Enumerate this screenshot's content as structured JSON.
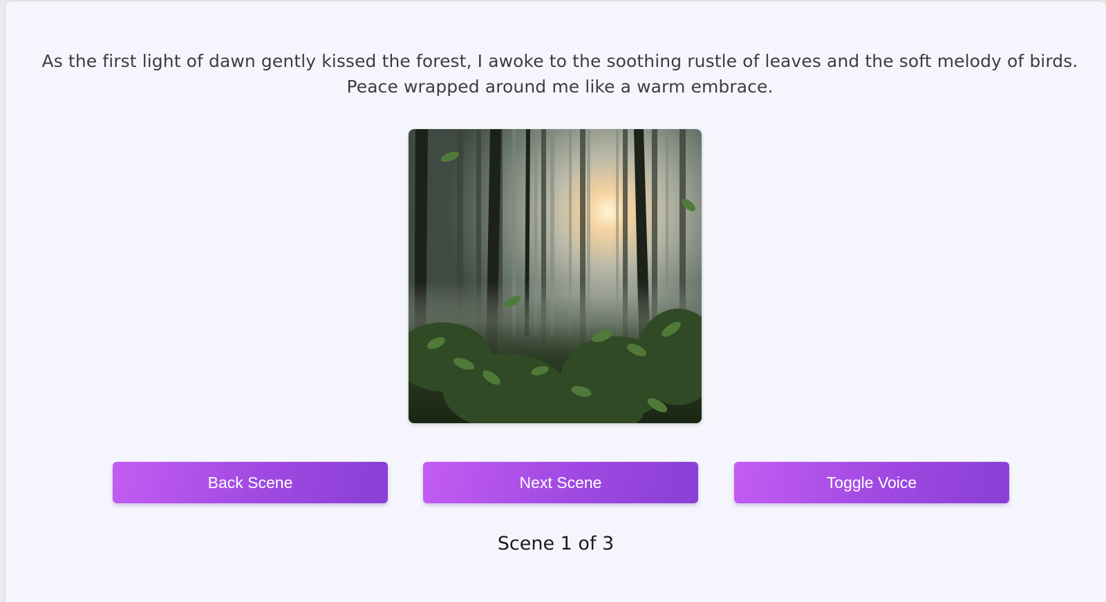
{
  "story": {
    "text": "As the first light of dawn gently kissed the forest, I awoke to the soothing rustle of leaves and the soft melody of birds. Peace wrapped around me like a warm embrace."
  },
  "scene_image": {
    "description_icon": "forest-dawn-image"
  },
  "controls": {
    "back_label": "Back Scene",
    "next_label": "Next Scene",
    "voice_label": "Toggle Voice"
  },
  "progress": {
    "label": "Scene 1 of 3",
    "current": 1,
    "total": 3
  },
  "colors": {
    "background": "#f5f6fd",
    "button_start": "#c35cf3",
    "button_end": "#8a3fd4",
    "button_text": "#ffffff"
  }
}
